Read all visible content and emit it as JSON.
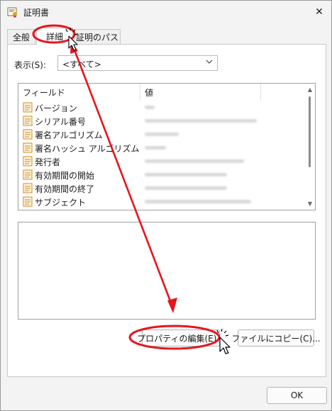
{
  "window": {
    "title": "証明書",
    "close_glyph": "✕"
  },
  "tabs": [
    {
      "label": "全般"
    },
    {
      "label": "詳細"
    },
    {
      "label": "証明のパス"
    }
  ],
  "show": {
    "label": "表示(S):",
    "value": "<すべて>"
  },
  "list": {
    "headers": {
      "field": "フィールド",
      "value": "値"
    },
    "rows": [
      {
        "label": "バージョン"
      },
      {
        "label": "シリアル番号"
      },
      {
        "label": "署名アルゴリズム"
      },
      {
        "label": "署名ハッシュ アルゴリズム"
      },
      {
        "label": "発行者"
      },
      {
        "label": "有効期間の開始"
      },
      {
        "label": "有効期間の終了"
      },
      {
        "label": "サブジェクト"
      }
    ]
  },
  "buttons": {
    "edit_properties": "プロパティの編集(E)...",
    "copy_to_file": "ファイルにコピー(C)...",
    "ok": "OK"
  },
  "colors": {
    "annotation_red": "#e8141c",
    "row_icon": "#c98b2a"
  }
}
